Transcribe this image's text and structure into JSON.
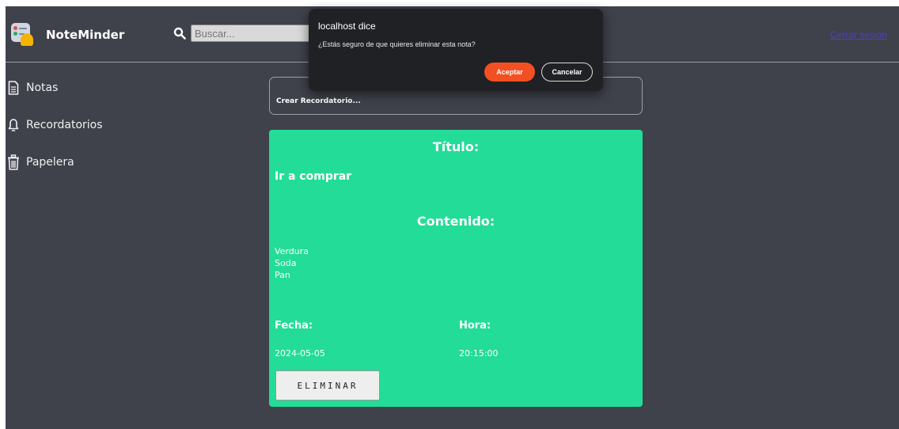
{
  "app": {
    "name": "NoteMinder",
    "search_placeholder": "Buscar...",
    "logout_label": "Cerrar sesión"
  },
  "sidebar": {
    "items": [
      {
        "label": "Notas",
        "icon": "document-icon"
      },
      {
        "label": "Recordatorios",
        "icon": "bell-icon"
      },
      {
        "label": "Papelera",
        "icon": "trash-icon"
      }
    ]
  },
  "create_reminder_label": "Crear Recordatorio...",
  "note": {
    "title_header": "Título:",
    "title": "Ir a comprar",
    "content_header": "Contenido:",
    "content_lines": [
      "Verdura",
      "Soda",
      "Pan"
    ],
    "date_label": "Fecha:",
    "date": "2024-05-05",
    "time_label": "Hora:",
    "time": "20:15:00",
    "delete_label": "ELIMINAR",
    "color": "#22dc97"
  },
  "dialog": {
    "title": "localhost dice",
    "message": "¿Estás seguro de que quieres eliminar esta nota?",
    "accept_label": "Aceptar",
    "cancel_label": "Cancelar",
    "accept_color": "#f25022"
  }
}
